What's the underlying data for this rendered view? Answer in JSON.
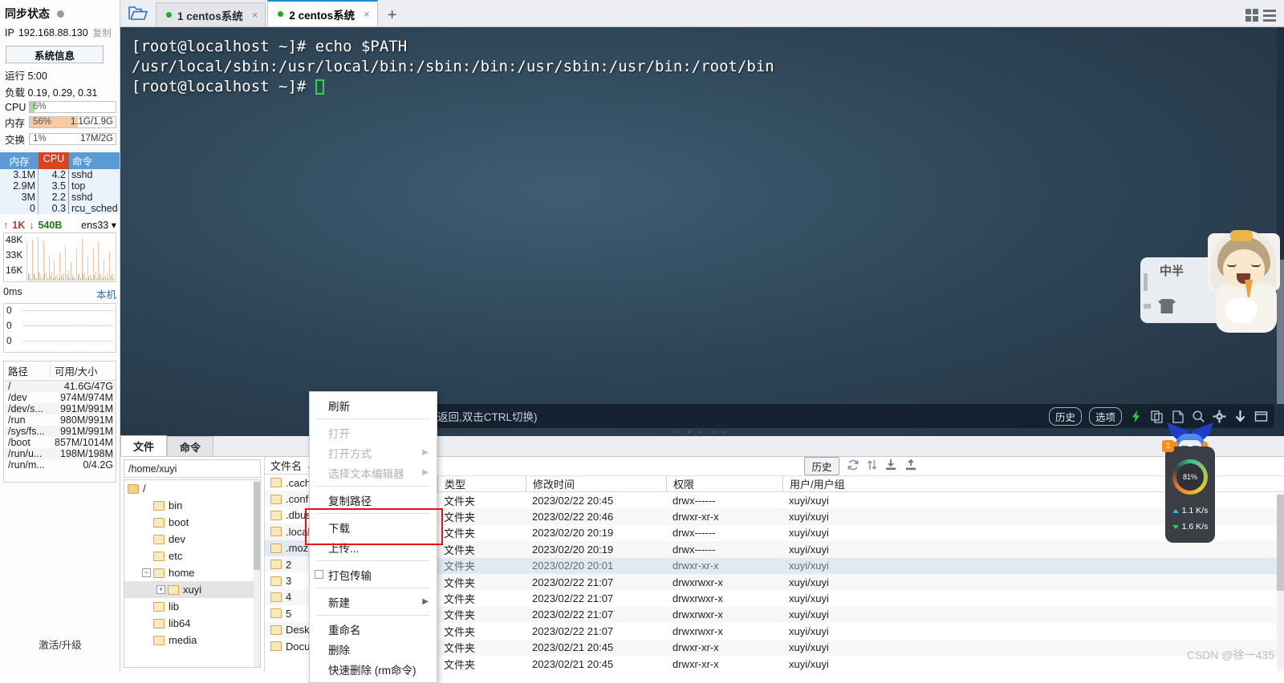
{
  "sidebar": {
    "sync_title": "同步状态",
    "ip_label": "IP",
    "ip_value": "192.168.88.130",
    "copy_label": "复制",
    "sysinfo_button": "系统信息",
    "uptime_label": "运行",
    "uptime_value": "5:00",
    "load_label": "负载",
    "load_value": "0.19, 0.29, 0.31",
    "cpu_label": "CPU",
    "cpu_pct": "6%",
    "cpu_fill_color": "#a8dba0",
    "mem_label": "内存",
    "mem_pct": "56%",
    "mem_amount": "1.1G/1.9G",
    "mem_fill_color": "#f8c9a2",
    "swap_label": "交换",
    "swap_pct": "1%",
    "swap_amount": "17M/2G",
    "swap_fill_color": "#e8e8e8",
    "proc_headers": [
      "内存",
      "CPU",
      "命令"
    ],
    "proc_rows": [
      {
        "mem": "3.1M",
        "cpu": "4.2",
        "cmd": "sshd"
      },
      {
        "mem": "2.9M",
        "cpu": "3.5",
        "cmd": "top"
      },
      {
        "mem": "3M",
        "cpu": "2.2",
        "cmd": "sshd"
      },
      {
        "mem": "0",
        "cpu": "0.3",
        "cmd": "rcu_sched"
      }
    ],
    "net_up": "1K",
    "net_down": "540B",
    "net_iface": "ens33",
    "net_axis": [
      "48K",
      "33K",
      "16K"
    ],
    "ping_label": "0ms",
    "ping_host": "本机",
    "ping_axis": [
      "0",
      "0",
      "0"
    ],
    "disk_headers": [
      "路径",
      "可用/大小"
    ],
    "disk_rows": [
      {
        "path": "/",
        "size": "41.6G/47G"
      },
      {
        "path": "/dev",
        "size": "974M/974M"
      },
      {
        "path": "/dev/s...",
        "size": "991M/991M"
      },
      {
        "path": "/run",
        "size": "980M/991M"
      },
      {
        "path": "/sys/fs...",
        "size": "991M/991M"
      },
      {
        "path": "/boot",
        "size": "857M/1014M"
      },
      {
        "path": "/run/u...",
        "size": "198M/198M"
      },
      {
        "path": "/run/m...",
        "size": "0/4.2G"
      }
    ],
    "activate_label": "激活/升级"
  },
  "tabbar": {
    "folder_icon": "open-folder-icon",
    "tabs": [
      {
        "label": "1 centos系统",
        "active": false,
        "close": "×"
      },
      {
        "label": "2 centos系统",
        "active": true,
        "close": "×"
      }
    ],
    "new_tab": "+",
    "grid_icon": "grid-view-icon",
    "menu_icon": "list-menu-icon"
  },
  "terminal": {
    "lines": [
      "[root@localhost ~]# echo $PATH",
      "/usr/local/sbin:/usr/local/bin:/sbin:/bin:/usr/sbin:/usr/bin:/root/bin",
      "[root@localhost ~]# "
    ],
    "line1": "[root@localhost ~]# echo $PATH",
    "line2": "/usr/local/sbin:/usr/local/bin:/sbin:/bin:/usr/sbin:/usr/bin:/root/bin",
    "line3": "[root@localhost ~]# "
  },
  "cmdbar": {
    "placeholder": "命令输入 (按ALT键返回,双击CTRL切换)",
    "history_label": "历史",
    "options_label": "选项",
    "icons": [
      "lightning-icon",
      "copy-icon",
      "paste-icon",
      "search-icon",
      "gear-icon",
      "download-icon",
      "window-icon"
    ]
  },
  "filepanel": {
    "tabs": [
      {
        "label": "文件",
        "active": true
      },
      {
        "label": "命令",
        "active": false
      }
    ],
    "path_value": "/home/xuyi",
    "tree": [
      {
        "label": "/",
        "depth": 0,
        "expander": "",
        "selected": false
      },
      {
        "label": "bin",
        "depth": 1,
        "expander": "",
        "selected": false
      },
      {
        "label": "boot",
        "depth": 1,
        "expander": "",
        "selected": false
      },
      {
        "label": "dev",
        "depth": 1,
        "expander": "",
        "selected": false
      },
      {
        "label": "etc",
        "depth": 1,
        "expander": "",
        "selected": false
      },
      {
        "label": "home",
        "depth": 1,
        "expander": "−",
        "selected": false
      },
      {
        "label": "xuyi",
        "depth": 2,
        "expander": "+",
        "selected": true
      },
      {
        "label": "lib",
        "depth": 1,
        "expander": "",
        "selected": false
      },
      {
        "label": "lib64",
        "depth": 1,
        "expander": "",
        "selected": false
      },
      {
        "label": "media",
        "depth": 1,
        "expander": "",
        "selected": false
      }
    ],
    "filename_header": "文件名",
    "sort_arrow": "▲",
    "file_toolbar_history": "历史",
    "file_toolbar_icons": [
      "refresh-icon",
      "sort-icon",
      "download-icon",
      "upload-icon"
    ],
    "columns": [
      "类型",
      "修改时间",
      "权限",
      "用户/用户组"
    ],
    "rows": [
      {
        "name": ".cache",
        "type": "文件夹",
        "time": "2023/02/22 20:45",
        "perm": "drwx------",
        "user": "xuyi/xuyi",
        "selected": false
      },
      {
        "name": ".config",
        "type": "文件夹",
        "time": "2023/02/22 20:46",
        "perm": "drwxr-xr-x",
        "user": "xuyi/xuyi",
        "selected": false
      },
      {
        "name": ".dbus",
        "type": "文件夹",
        "time": "2023/02/20 20:19",
        "perm": "drwx------",
        "user": "xuyi/xuyi",
        "selected": false
      },
      {
        "name": ".local",
        "type": "文件夹",
        "time": "2023/02/20 20:19",
        "perm": "drwx------",
        "user": "xuyi/xuyi",
        "selected": false
      },
      {
        "name": ".mozilla",
        "type": "文件夹",
        "time": "2023/02/20 20:01",
        "perm": "drwxr-xr-x",
        "user": "xuyi/xuyi",
        "selected": true
      },
      {
        "name": "2",
        "type": "文件夹",
        "time": "2023/02/22 21:07",
        "perm": "drwxrwxr-x",
        "user": "xuyi/xuyi",
        "selected": false
      },
      {
        "name": "3",
        "type": "文件夹",
        "time": "2023/02/22 21:07",
        "perm": "drwxrwxr-x",
        "user": "xuyi/xuyi",
        "selected": false
      },
      {
        "name": "4",
        "type": "文件夹",
        "time": "2023/02/22 21:07",
        "perm": "drwxrwxr-x",
        "user": "xuyi/xuyi",
        "selected": false
      },
      {
        "name": "5",
        "type": "文件夹",
        "time": "2023/02/22 21:07",
        "perm": "drwxrwxr-x",
        "user": "xuyi/xuyi",
        "selected": false
      },
      {
        "name": "Desktop",
        "type": "文件夹",
        "time": "2023/02/21 20:45",
        "perm": "drwxr-xr-x",
        "user": "xuyi/xuyi",
        "selected": false
      },
      {
        "name": "Documents",
        "type": "文件夹",
        "time": "2023/02/21 20:45",
        "perm": "drwxr-xr-x",
        "user": "xuyi/xuyi",
        "selected": false
      }
    ]
  },
  "contextmenu": {
    "items": [
      {
        "label": "刷新",
        "disabled": false,
        "submenu": false,
        "checkbox": false,
        "sep_after": true
      },
      {
        "label": "打开",
        "disabled": true,
        "submenu": false,
        "checkbox": false,
        "sep_after": false
      },
      {
        "label": "打开方式",
        "disabled": true,
        "submenu": true,
        "checkbox": false,
        "sep_after": false
      },
      {
        "label": "选择文本编辑器",
        "disabled": true,
        "submenu": true,
        "checkbox": false,
        "sep_after": true
      },
      {
        "label": "复制路径",
        "disabled": false,
        "submenu": false,
        "checkbox": false,
        "sep_after": true
      },
      {
        "label": "下载",
        "disabled": false,
        "submenu": false,
        "checkbox": false,
        "sep_after": false
      },
      {
        "label": "上传...",
        "disabled": false,
        "submenu": false,
        "checkbox": false,
        "sep_after": true
      },
      {
        "label": "打包传输",
        "disabled": false,
        "submenu": false,
        "checkbox": true,
        "sep_after": true
      },
      {
        "label": "新建",
        "disabled": false,
        "submenu": true,
        "checkbox": false,
        "sep_after": true
      },
      {
        "label": "重命名",
        "disabled": false,
        "submenu": false,
        "checkbox": false,
        "sep_after": false
      },
      {
        "label": "删除",
        "disabled": false,
        "submenu": false,
        "checkbox": false,
        "sep_after": false
      },
      {
        "label": "快速删除 (rm命令)",
        "disabled": false,
        "submenu": false,
        "checkbox": false,
        "sep_after": false
      }
    ],
    "highlight_color": "#e8111b"
  },
  "overlays": {
    "mascot_text": "中半",
    "mascot_icon": "shirt-icon",
    "netwidget_badge": "1",
    "netwidget_percent": "81",
    "netwidget_percent_unit": "%",
    "netwidget_up": "1.1 K/s",
    "netwidget_down": "1.6 K/s",
    "robot_icon": "blue-robot-mascot-icon",
    "watermark": "CSDN @徐一435"
  }
}
